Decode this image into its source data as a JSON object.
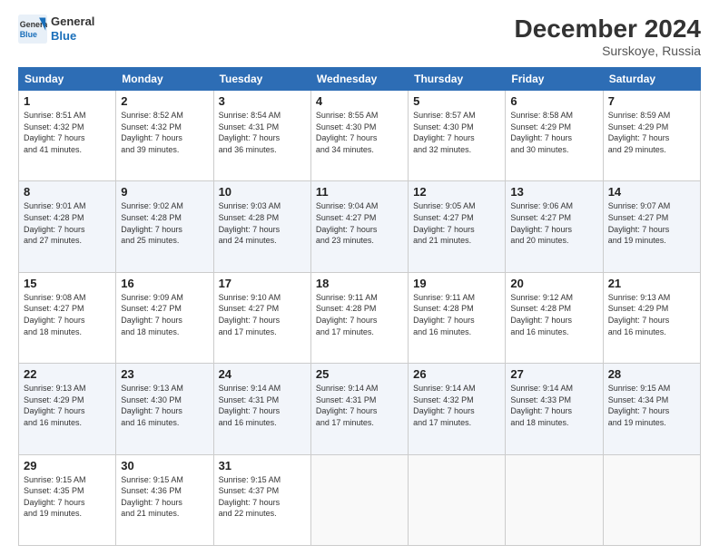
{
  "header": {
    "logo_line1": "General",
    "logo_line2": "Blue",
    "month_year": "December 2024",
    "location": "Surskoye, Russia"
  },
  "days_of_week": [
    "Sunday",
    "Monday",
    "Tuesday",
    "Wednesday",
    "Thursday",
    "Friday",
    "Saturday"
  ],
  "weeks": [
    [
      {
        "day": "1",
        "sunrise": "8:51 AM",
        "sunset": "4:32 PM",
        "daylight": "7 hours and 41 minutes."
      },
      {
        "day": "2",
        "sunrise": "8:52 AM",
        "sunset": "4:32 PM",
        "daylight": "7 hours and 39 minutes."
      },
      {
        "day": "3",
        "sunrise": "8:54 AM",
        "sunset": "4:31 PM",
        "daylight": "7 hours and 36 minutes."
      },
      {
        "day": "4",
        "sunrise": "8:55 AM",
        "sunset": "4:30 PM",
        "daylight": "7 hours and 34 minutes."
      },
      {
        "day": "5",
        "sunrise": "8:57 AM",
        "sunset": "4:30 PM",
        "daylight": "7 hours and 32 minutes."
      },
      {
        "day": "6",
        "sunrise": "8:58 AM",
        "sunset": "4:29 PM",
        "daylight": "7 hours and 30 minutes."
      },
      {
        "day": "7",
        "sunrise": "8:59 AM",
        "sunset": "4:29 PM",
        "daylight": "7 hours and 29 minutes."
      }
    ],
    [
      {
        "day": "8",
        "sunrise": "9:01 AM",
        "sunset": "4:28 PM",
        "daylight": "7 hours and 27 minutes."
      },
      {
        "day": "9",
        "sunrise": "9:02 AM",
        "sunset": "4:28 PM",
        "daylight": "7 hours and 25 minutes."
      },
      {
        "day": "10",
        "sunrise": "9:03 AM",
        "sunset": "4:28 PM",
        "daylight": "7 hours and 24 minutes."
      },
      {
        "day": "11",
        "sunrise": "9:04 AM",
        "sunset": "4:27 PM",
        "daylight": "7 hours and 23 minutes."
      },
      {
        "day": "12",
        "sunrise": "9:05 AM",
        "sunset": "4:27 PM",
        "daylight": "7 hours and 21 minutes."
      },
      {
        "day": "13",
        "sunrise": "9:06 AM",
        "sunset": "4:27 PM",
        "daylight": "7 hours and 20 minutes."
      },
      {
        "day": "14",
        "sunrise": "9:07 AM",
        "sunset": "4:27 PM",
        "daylight": "7 hours and 19 minutes."
      }
    ],
    [
      {
        "day": "15",
        "sunrise": "9:08 AM",
        "sunset": "4:27 PM",
        "daylight": "7 hours and 18 minutes."
      },
      {
        "day": "16",
        "sunrise": "9:09 AM",
        "sunset": "4:27 PM",
        "daylight": "7 hours and 18 minutes."
      },
      {
        "day": "17",
        "sunrise": "9:10 AM",
        "sunset": "4:27 PM",
        "daylight": "7 hours and 17 minutes."
      },
      {
        "day": "18",
        "sunrise": "9:11 AM",
        "sunset": "4:28 PM",
        "daylight": "7 hours and 17 minutes."
      },
      {
        "day": "19",
        "sunrise": "9:11 AM",
        "sunset": "4:28 PM",
        "daylight": "7 hours and 16 minutes."
      },
      {
        "day": "20",
        "sunrise": "9:12 AM",
        "sunset": "4:28 PM",
        "daylight": "7 hours and 16 minutes."
      },
      {
        "day": "21",
        "sunrise": "9:13 AM",
        "sunset": "4:29 PM",
        "daylight": "7 hours and 16 minutes."
      }
    ],
    [
      {
        "day": "22",
        "sunrise": "9:13 AM",
        "sunset": "4:29 PM",
        "daylight": "7 hours and 16 minutes."
      },
      {
        "day": "23",
        "sunrise": "9:13 AM",
        "sunset": "4:30 PM",
        "daylight": "7 hours and 16 minutes."
      },
      {
        "day": "24",
        "sunrise": "9:14 AM",
        "sunset": "4:31 PM",
        "daylight": "7 hours and 16 minutes."
      },
      {
        "day": "25",
        "sunrise": "9:14 AM",
        "sunset": "4:31 PM",
        "daylight": "7 hours and 17 minutes."
      },
      {
        "day": "26",
        "sunrise": "9:14 AM",
        "sunset": "4:32 PM",
        "daylight": "7 hours and 17 minutes."
      },
      {
        "day": "27",
        "sunrise": "9:14 AM",
        "sunset": "4:33 PM",
        "daylight": "7 hours and 18 minutes."
      },
      {
        "day": "28",
        "sunrise": "9:15 AM",
        "sunset": "4:34 PM",
        "daylight": "7 hours and 19 minutes."
      }
    ],
    [
      {
        "day": "29",
        "sunrise": "9:15 AM",
        "sunset": "4:35 PM",
        "daylight": "7 hours and 19 minutes."
      },
      {
        "day": "30",
        "sunrise": "9:15 AM",
        "sunset": "4:36 PM",
        "daylight": "7 hours and 21 minutes."
      },
      {
        "day": "31",
        "sunrise": "9:15 AM",
        "sunset": "4:37 PM",
        "daylight": "7 hours and 22 minutes."
      },
      null,
      null,
      null,
      null
    ]
  ],
  "labels": {
    "sunrise": "Sunrise:",
    "sunset": "Sunset:",
    "daylight": "Daylight:"
  }
}
